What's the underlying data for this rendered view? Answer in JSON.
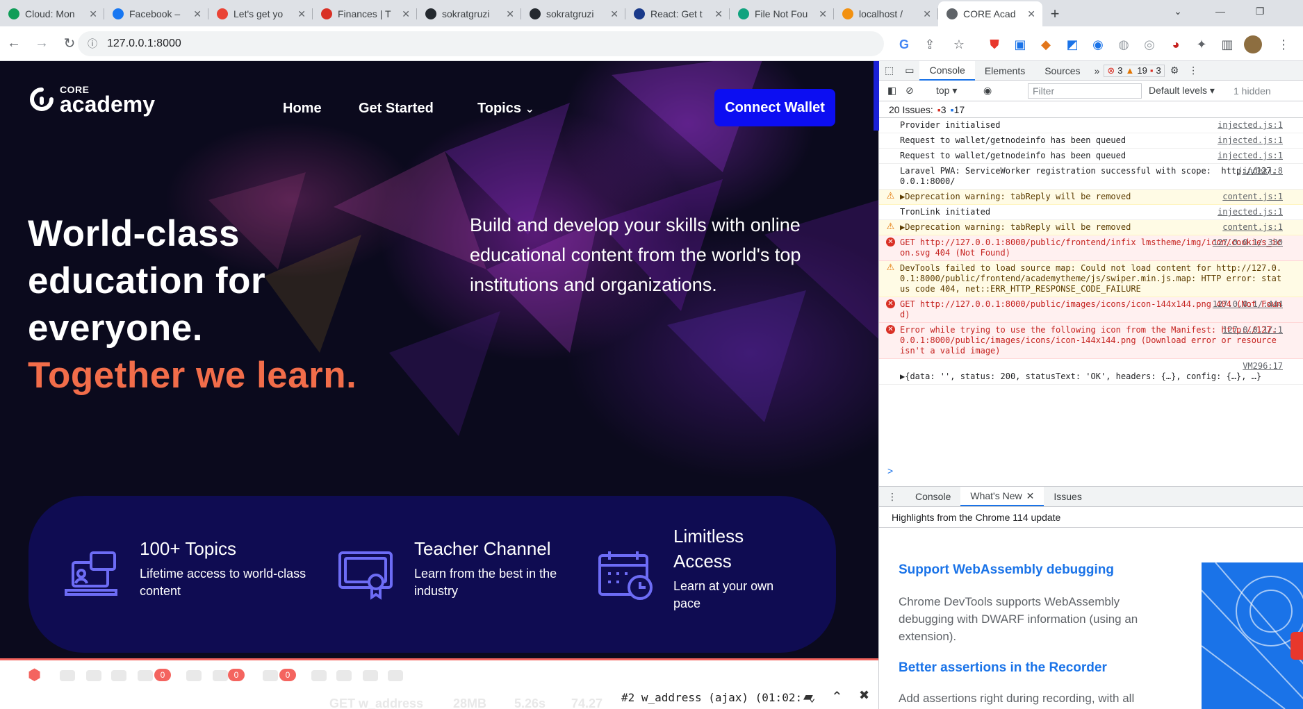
{
  "browser": {
    "tabs": [
      {
        "title": "Cloud: Mon",
        "icon": "cloud-favicon-icon",
        "color": "#0f9d58"
      },
      {
        "title": "Facebook –",
        "icon": "facebook-favicon-icon",
        "color": "#1877f2"
      },
      {
        "title": "Let's get yo",
        "icon": "gmail-favicon-icon",
        "color": "#ea4335"
      },
      {
        "title": "Finances | T",
        "icon": "finances-favicon-icon",
        "color": "#d93025"
      },
      {
        "title": "sokratgruzi",
        "icon": "github-favicon-icon",
        "color": "#24292f"
      },
      {
        "title": "sokratgruzi",
        "icon": "github-favicon-icon",
        "color": "#24292f"
      },
      {
        "title": "React: Get t",
        "icon": "react-favicon-icon",
        "color": "#1a3a8a"
      },
      {
        "title": "File Not Fou",
        "icon": "openai-favicon-icon",
        "color": "#10a37f"
      },
      {
        "title": "localhost /",
        "icon": "phpmyadmin-favicon-icon",
        "color": "#f29111"
      },
      {
        "title": "CORE Acad",
        "icon": "globe-favicon-icon",
        "color": "#5f6368",
        "active": true
      }
    ],
    "new_tab": "+",
    "url": "127.0.0.1:8000"
  },
  "site": {
    "logo_top": "CORE",
    "logo_bottom": "academy",
    "nav": {
      "home": "Home",
      "get_started": "Get Started",
      "topics": "Topics"
    },
    "connect_wallet": "Connect Wallet",
    "hero_line1": "World-class",
    "hero_line2": "education for",
    "hero_line3": "everyone.",
    "hero_accent": "Together we learn.",
    "lead": "Build and develop your skills with online educational content from the world's top institutions and organizations.",
    "features": [
      {
        "title": "100+ Topics",
        "desc": "Lifetime access to world-class content",
        "icon": "laptop-icon"
      },
      {
        "title": "Teacher Channel",
        "desc": "Learn from the best in the industry",
        "icon": "certificate-icon"
      },
      {
        "title": "Limitless Access",
        "desc": "Learn at your own pace",
        "icon": "calendar-clock-icon"
      }
    ],
    "accent_color": "#f26d4a",
    "button_color": "#0c0ef2"
  },
  "debugbar": {
    "badges": [
      "0",
      "0",
      "0"
    ],
    "stats": [
      "GET w_address",
      "28MB",
      "5.26s",
      "74.27"
    ],
    "request": "#2 w_address (ajax) (01:02:"
  },
  "devtools": {
    "tabs": [
      "Console",
      "Elements",
      "Sources"
    ],
    "more": "»",
    "errors": "3",
    "warnings": "19",
    "issues_badge": "3",
    "context": "top",
    "filter_placeholder": "Filter",
    "levels": "Default levels",
    "hidden": "1 hidden",
    "issues_label": "20 Issues:",
    "issues_err": "3",
    "issues_info": "17",
    "logs": [
      {
        "type": "info",
        "text": "Provider initialised",
        "src": "injected.js:1"
      },
      {
        "type": "info",
        "text": "Request to wallet/getnodeinfo has been queued",
        "src": "injected.js:1"
      },
      {
        "type": "info",
        "text": "Request to wallet/getnodeinfo has been queued",
        "src": "injected.js:1"
      },
      {
        "type": "info",
        "text": "Laravel PWA: ServiceWorker registration successful with scope:  http://127.0.0.1:8000/",
        "src": "(index):8"
      },
      {
        "type": "warn",
        "text": "▶Deprecation warning: tabReply will be removed",
        "src": "content.js:1"
      },
      {
        "type": "info",
        "text": "TronLink initiated",
        "src": "injected.js:1"
      },
      {
        "type": "warn",
        "text": "▶Deprecation warning: tabReply will be removed",
        "src": "content.js:1"
      },
      {
        "type": "err",
        "text": "GET http://127.0.0.1:8000/public/frontend/infix lmstheme/img/icon/cookies_icon.svg 404 (Not Found)",
        "src": "127.0.0.1/:330"
      },
      {
        "type": "warn",
        "text": "DevTools failed to load source map: Could not load content for http://127.0.0.1:8000/public/frontend/academytheme/js/swiper.min.js.map: HTTP error: status code 404, net::ERR_HTTP_RESPONSE_CODE_FAILURE",
        "src": ""
      },
      {
        "type": "err",
        "text": "GET http://127.0.0.1:8000/public/images/icons/icon-144x144.png 404 (Not Found)",
        "src": "127.0.0.1/:444"
      },
      {
        "type": "err",
        "text": "Error while trying to use the following icon from the Manifest: http://127.0.0.1:8000/public/images/icons/icon-144x144.png (Download error or resource isn't a valid image)",
        "src": "127.0.0.1/:1"
      },
      {
        "type": "info",
        "text": "\n▶{data: '', status: 200, statusText: 'OK', headers: {…}, config: {…}, …}",
        "src": "VM296:17"
      }
    ],
    "prompt": ">",
    "drawer_tabs": [
      "Console",
      "What's New",
      "Issues"
    ],
    "drawer_sub": "Highlights from the Chrome 114 update",
    "whats_new": [
      {
        "title": "Support WebAssembly debugging",
        "body": "Chrome DevTools supports WebAssembly debugging with DWARF information (using an extension)."
      },
      {
        "title": "Better assertions in the Recorder",
        "body": "Add assertions right during recording, with all"
      }
    ]
  }
}
